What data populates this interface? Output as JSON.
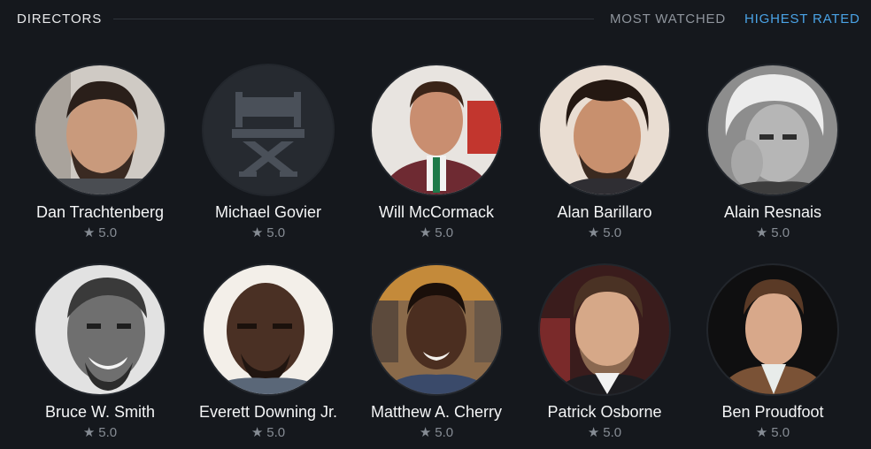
{
  "header": {
    "title": "DIRECTORS",
    "tabs": [
      {
        "label": "MOST WATCHED",
        "active": false
      },
      {
        "label": "HIGHEST RATED",
        "active": true
      }
    ]
  },
  "colors": {
    "background": "#15181d",
    "active_tab": "#4aa3e6",
    "inactive_tab": "#8f959d",
    "rating_text": "#868c94"
  },
  "directors": [
    {
      "name": "Dan Trachtenberg",
      "rating": "5.0",
      "icon": "star-icon",
      "photo": "portrait"
    },
    {
      "name": "Michael Govier",
      "rating": "5.0",
      "icon": "star-icon",
      "photo": "director-chair-placeholder"
    },
    {
      "name": "Will McCormack",
      "rating": "5.0",
      "icon": "star-icon",
      "photo": "portrait"
    },
    {
      "name": "Alan Barillaro",
      "rating": "5.0",
      "icon": "star-icon",
      "photo": "portrait"
    },
    {
      "name": "Alain Resnais",
      "rating": "5.0",
      "icon": "star-icon",
      "photo": "portrait-bw"
    },
    {
      "name": "Bruce W. Smith",
      "rating": "5.0",
      "icon": "star-icon",
      "photo": "portrait-bw"
    },
    {
      "name": "Everett Downing Jr.",
      "rating": "5.0",
      "icon": "star-icon",
      "photo": "portrait"
    },
    {
      "name": "Matthew A. Cherry",
      "rating": "5.0",
      "icon": "star-icon",
      "photo": "portrait"
    },
    {
      "name": "Patrick Osborne",
      "rating": "5.0",
      "icon": "star-icon",
      "photo": "portrait"
    },
    {
      "name": "Ben Proudfoot",
      "rating": "5.0",
      "icon": "star-icon",
      "photo": "portrait"
    }
  ]
}
